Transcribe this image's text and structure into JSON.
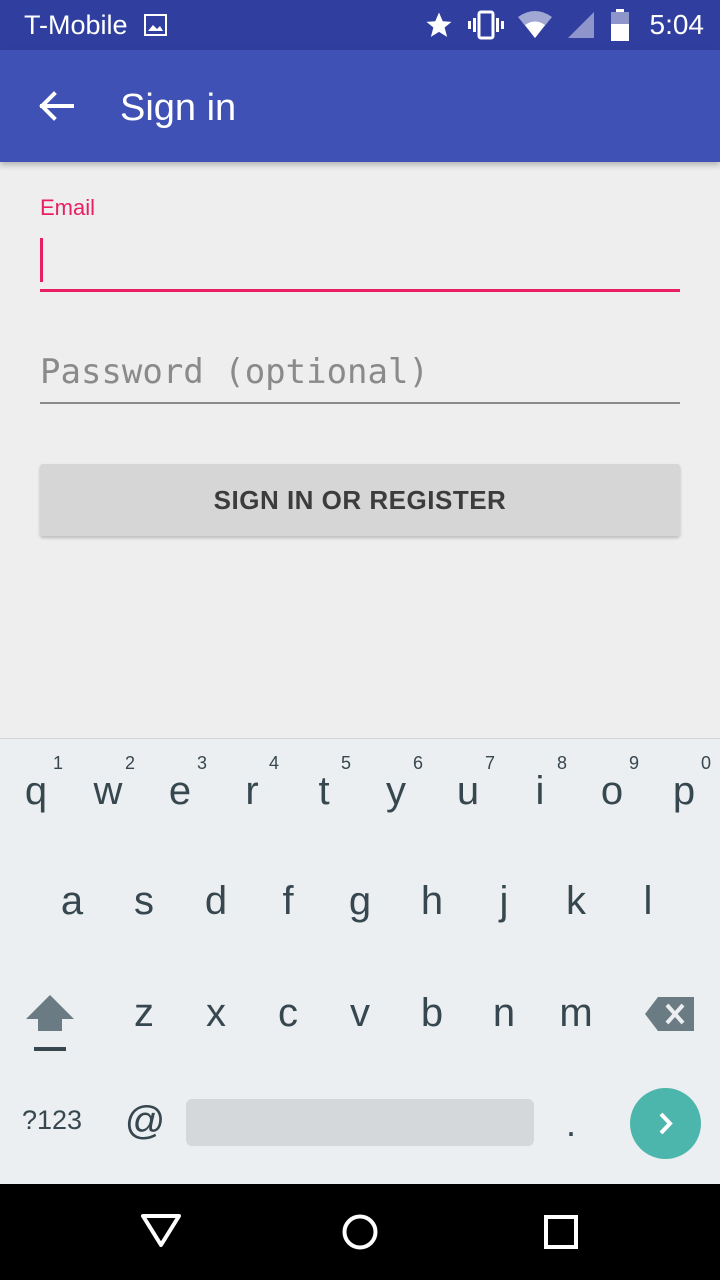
{
  "status_bar": {
    "carrier": "T-Mobile",
    "time": "5:04",
    "icons": [
      "image-notification-icon",
      "star-icon",
      "vibrate-icon",
      "wifi-icon",
      "cell-signal-icon",
      "battery-icon"
    ]
  },
  "app_bar": {
    "title": "Sign in",
    "back_icon": "arrow-back-icon",
    "color": "#3f51b5"
  },
  "form": {
    "email_label": "Email",
    "email_value": "",
    "password_placeholder": "Password (optional)",
    "button_label": "SIGN IN OR REGISTER",
    "accent_color": "#e91e63"
  },
  "keyboard": {
    "row1": [
      "q",
      "w",
      "e",
      "r",
      "t",
      "y",
      "u",
      "i",
      "o",
      "p"
    ],
    "row1_hints": [
      "1",
      "2",
      "3",
      "4",
      "5",
      "6",
      "7",
      "8",
      "9",
      "0"
    ],
    "row2": [
      "a",
      "s",
      "d",
      "f",
      "g",
      "h",
      "j",
      "k",
      "l"
    ],
    "row3": [
      "z",
      "x",
      "c",
      "v",
      "b",
      "n",
      "m"
    ],
    "symbols_label": "?123",
    "at_label": "@",
    "period_label": ".",
    "enter_color": "#4db6ac"
  },
  "nav_bar": {
    "icons": [
      "nav-back-icon",
      "nav-home-icon",
      "nav-recents-icon"
    ]
  }
}
